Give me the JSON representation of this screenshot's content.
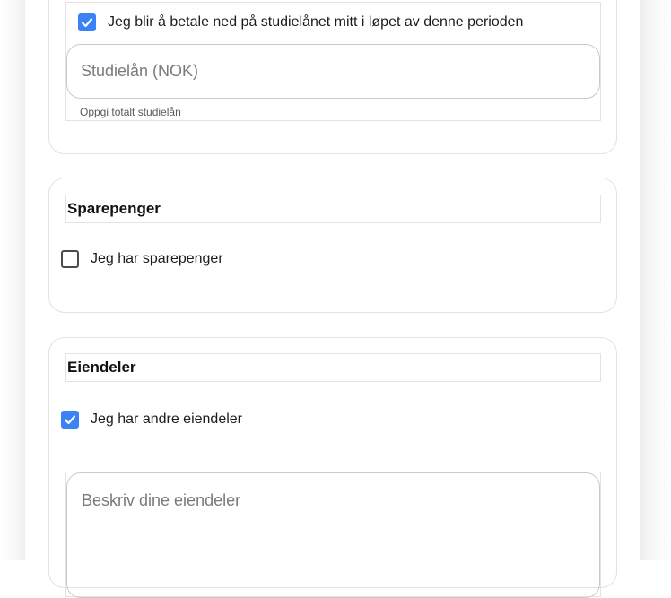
{
  "studielan": {
    "checkbox_label": "Jeg blir å betale ned på studielånet mitt i løpet av denne perioden",
    "checked": true,
    "input_placeholder": "Studielån (NOK)",
    "helper_text": "Oppgi totalt studielån"
  },
  "sparepenger": {
    "heading": "Sparepenger",
    "checkbox_label": "Jeg har sparepenger",
    "checked": false
  },
  "eiendeler": {
    "heading": "Eiendeler",
    "checkbox_label": "Jeg har andre eiendeler",
    "checked": true,
    "textarea_placeholder": "Beskriv dine eiendeler"
  },
  "colors": {
    "checkbox_checked": "#3b82f6",
    "card_border": "#e2e2e2",
    "input_border": "#c9c9c9",
    "placeholder_text": "#7a7a7a"
  }
}
